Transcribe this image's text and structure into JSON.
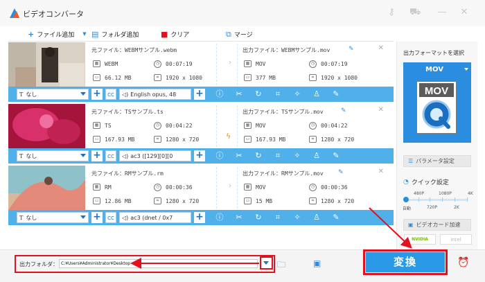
{
  "app": {
    "title": "ビデオコンバータ"
  },
  "toolbar": {
    "add_file": "ファイル追加",
    "add_folder": "フォルダ追加",
    "clear": "クリア",
    "merge": "マージ"
  },
  "rows": [
    {
      "source": "元ファイル：WEBMサンプル.webm",
      "src_format": "WEBM",
      "src_duration": "00:07:19",
      "src_size": "66.12 MB",
      "src_res": "1920 x 1080",
      "output": "出力ファイル：WEBMサンプル.mov",
      "out_format": "MOV",
      "out_duration": "00:07:19",
      "out_size": "377 MB",
      "out_res": "1920 x 1080",
      "subtitle": "なし",
      "audio": "English opus, 48"
    },
    {
      "source": "元ファイル：TSサンプル.ts",
      "src_format": "TS",
      "src_duration": "00:04:22",
      "src_size": "167.93 MB",
      "src_res": "1280 x 720",
      "output": "出力ファイル：TSサンプル.mov",
      "out_format": "MOV",
      "out_duration": "00:04:22",
      "out_size": "167.93 MB",
      "out_res": "1280 x 720",
      "subtitle": "なし",
      "audio": "ac3 ([129][0][0"
    },
    {
      "source": "元ファイル：RMサンプル.rm",
      "src_format": "RM",
      "src_duration": "00:00:36",
      "src_size": "12.86 MB",
      "src_res": "1280 x 720",
      "output": "出力ファイル：RMサンプル.mov",
      "out_format": "MOV",
      "out_duration": "00:00:36",
      "out_size": "15 MB",
      "out_res": "1280 x 720",
      "subtitle": "なし",
      "audio": "ac3 (dnet / 0x7"
    }
  ],
  "cc_label": "CC",
  "right_panel": {
    "format_label": "出力フォーマットを選択",
    "format_name": "MOV",
    "format_icon_text": "MOV",
    "param_label": "パラメータ設定",
    "quick_label": "クイック設定",
    "slider_top": [
      "480P",
      "1080P",
      "4K"
    ],
    "slider_bottom": [
      "自動",
      "720P",
      "2K"
    ],
    "slider_value": "自動",
    "accel_label": "ビデオカード加速",
    "nvidia": "NVIDIA",
    "intel": "Intel"
  },
  "bottom": {
    "out_folder_label": "出力フォルダ：",
    "out_folder_path": "C:¥Users¥Administrator¥Desktop",
    "convert_label": "変換"
  },
  "colors": {
    "accent": "#2a8de0",
    "bar": "#4fb0ea",
    "highlight": "#e3101e"
  }
}
